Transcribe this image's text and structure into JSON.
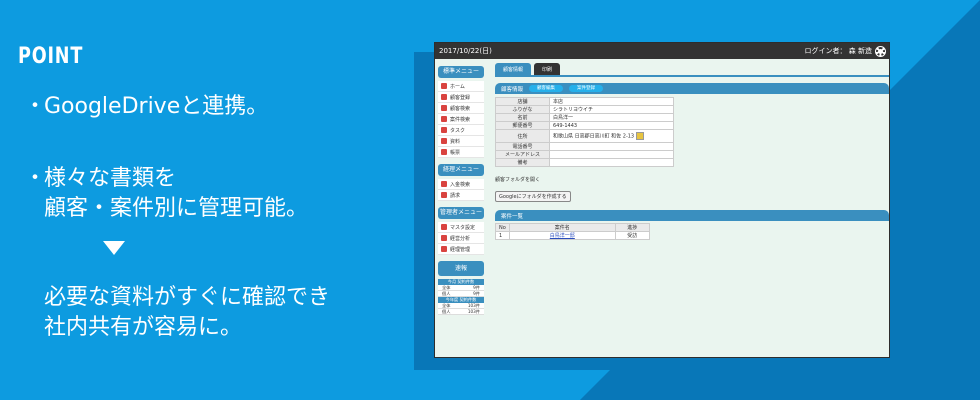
{
  "colors": {
    "background": "#0d9be0",
    "dark_triangle": "#0877b8",
    "accent": "#3a8fbf"
  },
  "promo": {
    "heading": "POINT",
    "bullet_glyph": "・",
    "bullet1": "GoogleDriveと連携。",
    "bullet2_line1": "様々な書類を",
    "bullet2_line2": "顧客・案件別に管理可能。",
    "result_line1": "必要な資料がすぐに確認でき",
    "result_line2": "社内共有が容易に。"
  },
  "app": {
    "date": "2017/10/22(日)",
    "login": "ログイン者： 森 新造",
    "menus": [
      {
        "title": "標準メニュー",
        "items": [
          "ホーム",
          "顧客登録",
          "顧客検索",
          "案件検索",
          "タスク",
          "資料",
          "帳票"
        ]
      },
      {
        "title": "経理メニュー",
        "items": [
          "入金検索",
          "請求"
        ]
      },
      {
        "title": "管理者メニュー",
        "items": [
          "マスタ設定",
          "経営分析",
          "経理管理"
        ]
      }
    ],
    "stats": {
      "title": "速報",
      "month_header": "今月 契約件数",
      "month_rows": [
        {
          "k": "全体",
          "v": "9件"
        },
        {
          "k": "個人",
          "v": "9件"
        }
      ],
      "year_header": "今年度 契約件数",
      "year_rows": [
        {
          "k": "全体",
          "v": "103件"
        },
        {
          "k": "個人",
          "v": "103件"
        }
      ]
    },
    "tabs": [
      "顧客情報",
      "印刷"
    ],
    "section1": {
      "title": "顧客情報",
      "pills": [
        "顧客編集",
        "案件登録"
      ]
    },
    "info_rows": [
      {
        "k": "店舗",
        "v": "本店"
      },
      {
        "k": "ふりがな",
        "v": "シラトリヨウイチ"
      },
      {
        "k": "名前",
        "v": "白鳥洋一"
      },
      {
        "k": "郵便番号",
        "v": "649-1443"
      },
      {
        "k": "住所",
        "v": "和歌山県 日高郡日高川町 和佐 2-13"
      },
      {
        "k": "電話番号",
        "v": ""
      },
      {
        "k": "メールアドレス",
        "v": ""
      },
      {
        "k": "備考",
        "v": ""
      }
    ],
    "folder_label": "顧客フォルダを開く",
    "folder_button": "Googleにフォルダを作成する",
    "section2": {
      "title": "案件一覧"
    },
    "list_headers": [
      "No",
      "案件名",
      "進捗"
    ],
    "list_rows": [
      {
        "no": "1",
        "name": "白鳥洋一邸",
        "status": "受訪"
      }
    ]
  }
}
